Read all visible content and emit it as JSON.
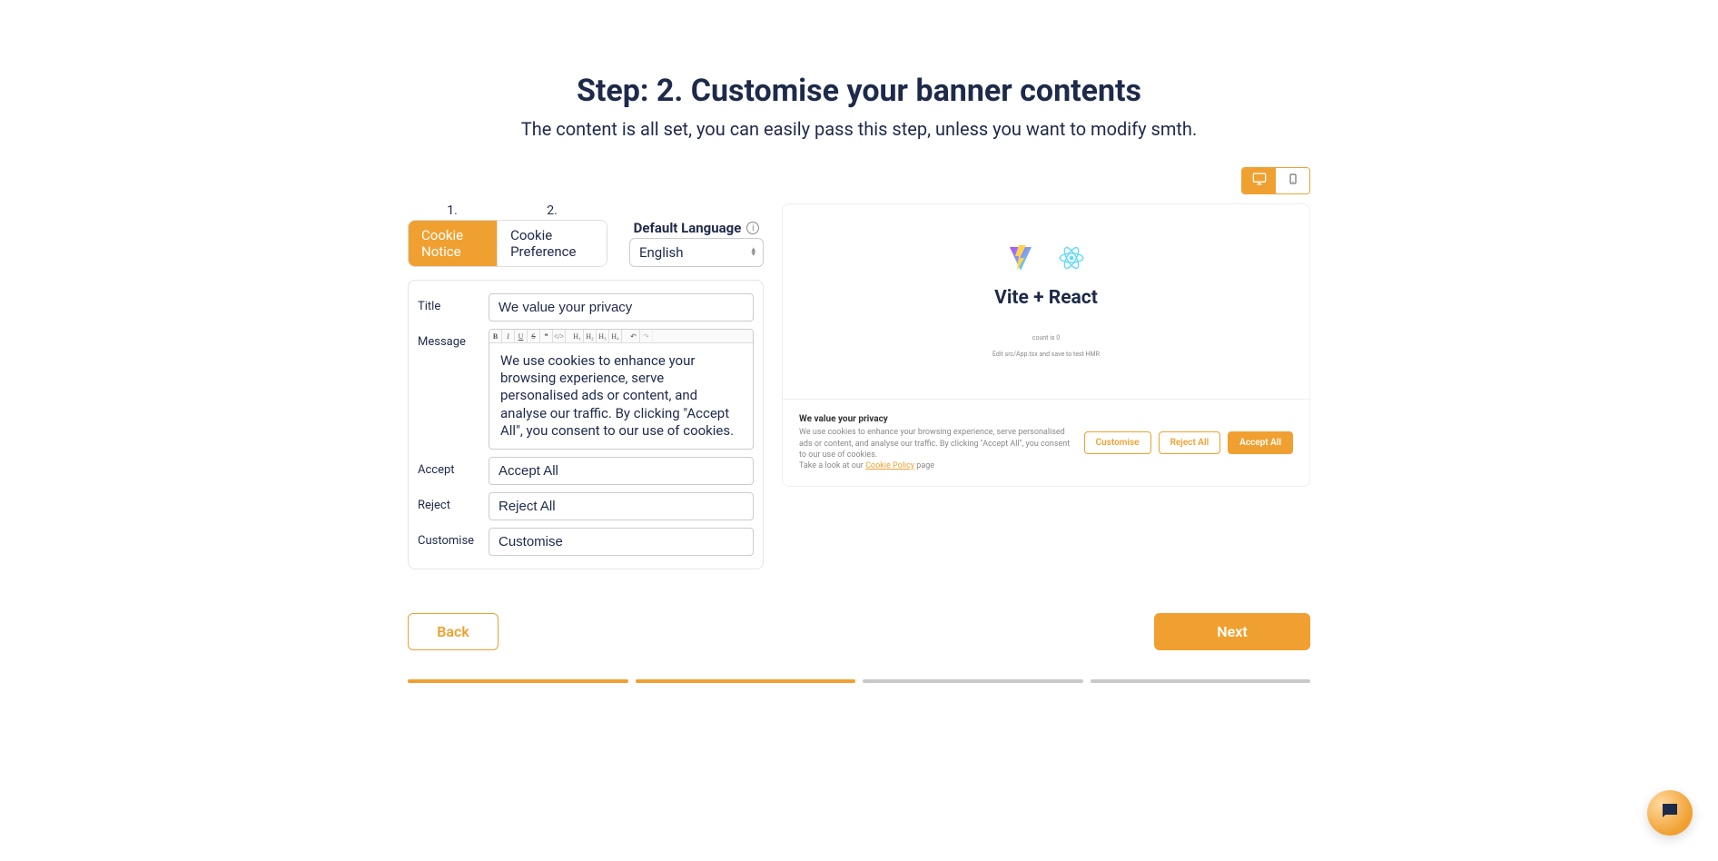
{
  "header": {
    "title": "Step: 2. Customise your banner contents",
    "subtitle": "The content is all set, you can easily pass this step, unless you want to modify smth."
  },
  "tabs": {
    "num1": "1.",
    "num2": "2.",
    "cookie_notice": "Cookie Notice",
    "cookie_preference": "Cookie Preference"
  },
  "language": {
    "label": "Default Language",
    "selected": "English"
  },
  "form": {
    "title_label": "Title",
    "title_value": "We value your privacy",
    "message_label": "Message",
    "message_value": "We use cookies to enhance your browsing experience, serve personalised ads or content, and analyse our traffic. By clicking \"Accept All\", you consent to our use of cookies.",
    "accept_label": "Accept",
    "accept_value": "Accept All",
    "reject_label": "Reject",
    "reject_value": "Reject All",
    "customise_label": "Customise",
    "customise_value": "Customise"
  },
  "editor_buttons": {
    "bold": "B",
    "italic": "I",
    "underline": "U",
    "strike": "S",
    "quote": "❝",
    "code": "</>",
    "h1": "H₁",
    "h2": "H₂",
    "h3": "H₃",
    "h4": "H₄",
    "undo": "↶",
    "redo": "↷"
  },
  "preview": {
    "app_title": "Vite + React",
    "tiny1": "count is 0",
    "tiny2": "Edit src/App.tsx and save to test HMR",
    "banner_title": "We value your privacy",
    "banner_msg1": "We use cookies to enhance your browsing experience, serve personalised ads or content, and analyse our traffic. By clicking \"Accept All\", you consent to our use of cookies.",
    "banner_msg2a": "Take a look at our ",
    "banner_policy": "Cookie Policy",
    "banner_msg2b": " page",
    "customise": "Customise",
    "reject": "Reject All",
    "accept": "Accept All"
  },
  "nav": {
    "back": "Back",
    "next": "Next"
  },
  "info_icon": "i"
}
